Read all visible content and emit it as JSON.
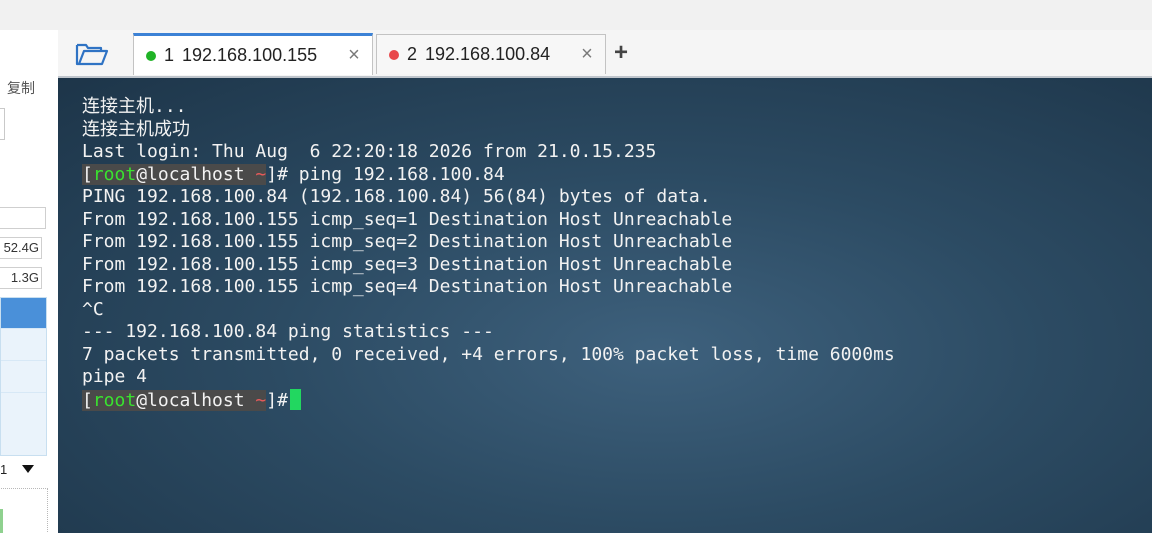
{
  "left_panel": {
    "copy_label": "复制",
    "sizes": [
      "52.4G",
      "1.3G"
    ],
    "dropdown_text": "1"
  },
  "tabs": [
    {
      "number": "1",
      "title": "192.168.100.155",
      "status_color": "#20b326",
      "close": "×",
      "active": true
    },
    {
      "number": "2",
      "title": "192.168.100.84",
      "status_color": "#e8474a",
      "close": "×",
      "active": false
    }
  ],
  "add_tab_label": "+",
  "folder_icon": "folder-open-icon",
  "terminal": {
    "line1": "连接主机...",
    "line2": "连接主机成功",
    "line3": "Last login: Thu Aug  6 22:20:18 2026 from 21.0.15.235",
    "prompt_open": "[",
    "prompt_user": "root",
    "prompt_host": "@localhost",
    "prompt_tilde": "~",
    "prompt_close": "]#",
    "command": " ping 192.168.100.84",
    "line5": "PING 192.168.100.84 (192.168.100.84) 56(84) bytes of data.",
    "line6": "From 192.168.100.155 icmp_seq=1 Destination Host Unreachable",
    "line7": "From 192.168.100.155 icmp_seq=2 Destination Host Unreachable",
    "line8": "From 192.168.100.155 icmp_seq=3 Destination Host Unreachable",
    "line9": "From 192.168.100.155 icmp_seq=4 Destination Host Unreachable",
    "line10": "^C",
    "line11": "--- 192.168.100.84 ping statistics ---",
    "line12": "7 packets transmitted, 0 received, +4 errors, 100% packet loss, time 6000ms",
    "line13": "pipe 4"
  }
}
